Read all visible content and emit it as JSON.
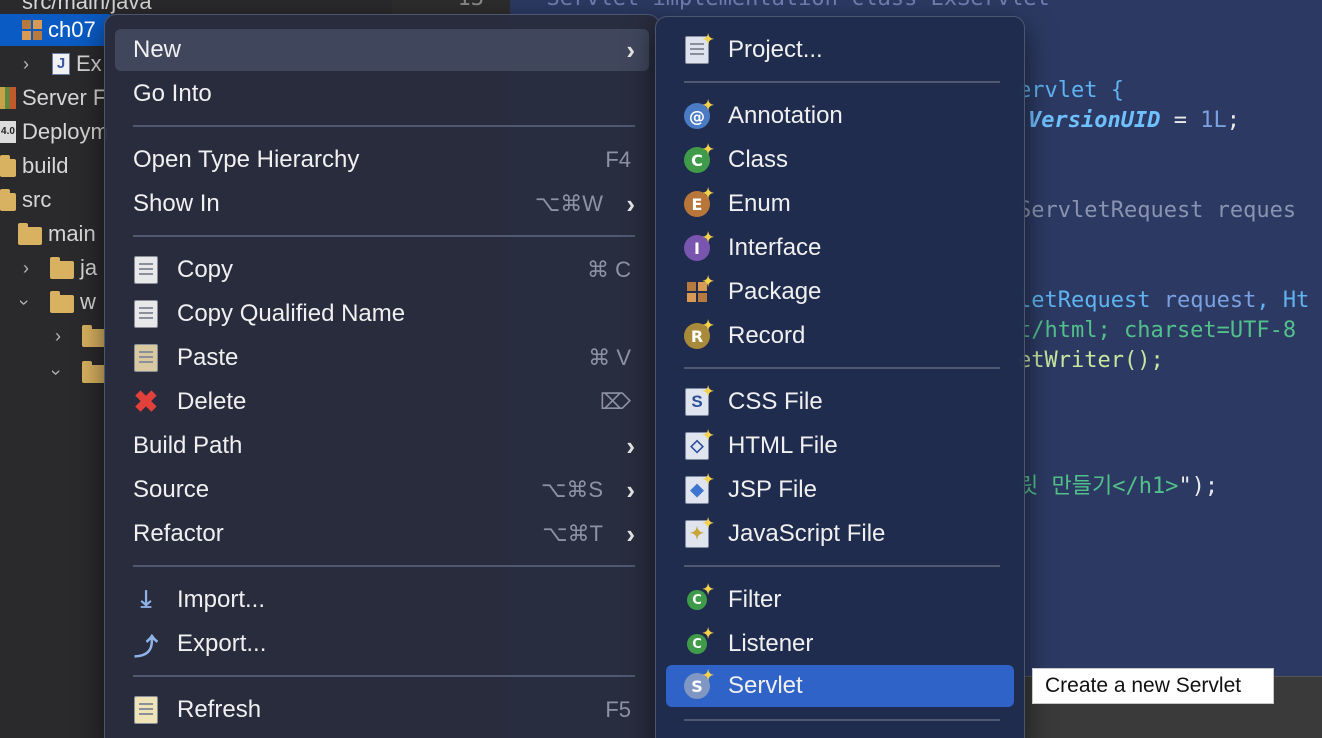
{
  "explorer": {
    "rows": [
      {
        "label": "src/main/java"
      },
      {
        "label": "ch07"
      },
      {
        "label": "Ex"
      },
      {
        "label": "Server F"
      },
      {
        "label": "Deploym"
      },
      {
        "label": "build"
      },
      {
        "label": "src"
      },
      {
        "label": "main"
      },
      {
        "label": "ja"
      },
      {
        "label": "w"
      }
    ]
  },
  "editor": {
    "line_number": "13",
    "comment": "* Servlet implementation class ExServlet",
    "code": {
      "l1": "ervlet {",
      "l2a": "VersionUID",
      "l2b": " = ",
      "l2c": "1L",
      "l2d": ";",
      "l3": "ServletRequest reques",
      "l4a": "letRequest ",
      "l4b": "request",
      "l4c": ", Ht",
      "l5": "t/html; charset=UTF-8",
      "l6": "etWriter();",
      "l7a": "릿 만들기</h1>",
      "l7b": "\");"
    }
  },
  "context_menu": {
    "items": {
      "new": {
        "label": "New"
      },
      "go_into": {
        "label": "Go Into"
      },
      "open_type_hierarchy": {
        "label": "Open Type Hierarchy",
        "shortcut": "F4"
      },
      "show_in": {
        "label": "Show In",
        "shortcut": "⌥⌘W"
      },
      "copy": {
        "label": "Copy",
        "shortcut": "⌘ C"
      },
      "copy_qualified_name": {
        "label": "Copy Qualified Name"
      },
      "paste": {
        "label": "Paste",
        "shortcut": "⌘ V"
      },
      "delete": {
        "label": "Delete",
        "shortcut": "⌦"
      },
      "build_path": {
        "label": "Build Path"
      },
      "source": {
        "label": "Source",
        "shortcut": "⌥⌘S"
      },
      "refactor": {
        "label": "Refactor",
        "shortcut": "⌥⌘T"
      },
      "import": {
        "label": "Import..."
      },
      "export": {
        "label": "Export..."
      },
      "refresh": {
        "label": "Refresh",
        "shortcut": "F5"
      }
    },
    "arrow": "›"
  },
  "submenu": {
    "items": {
      "project": {
        "label": "Project..."
      },
      "annotation": {
        "label": "Annotation",
        "glyph": "@"
      },
      "class": {
        "label": "Class",
        "glyph": "C"
      },
      "enum": {
        "label": "Enum",
        "glyph": "E"
      },
      "interface": {
        "label": "Interface",
        "glyph": "I"
      },
      "package": {
        "label": "Package"
      },
      "record": {
        "label": "Record",
        "glyph": "R"
      },
      "css_file": {
        "label": "CSS File",
        "glyph": "S"
      },
      "html_file": {
        "label": "HTML File",
        "glyph": "◇"
      },
      "jsp_file": {
        "label": "JSP File",
        "glyph": "◆"
      },
      "javascript_file": {
        "label": "JavaScript File",
        "glyph": "✦"
      },
      "filter": {
        "label": "Filter",
        "glyph": "C"
      },
      "listener": {
        "label": "Listener",
        "glyph": "C"
      },
      "servlet": {
        "label": "Servlet",
        "glyph": "S"
      }
    },
    "spark": "✦"
  },
  "tooltip": {
    "text": "Create a new Servlet"
  },
  "colors": {
    "accent": "#2f63c8",
    "selection": "#0a5bc4",
    "editor_bg": "#2c3a63"
  }
}
